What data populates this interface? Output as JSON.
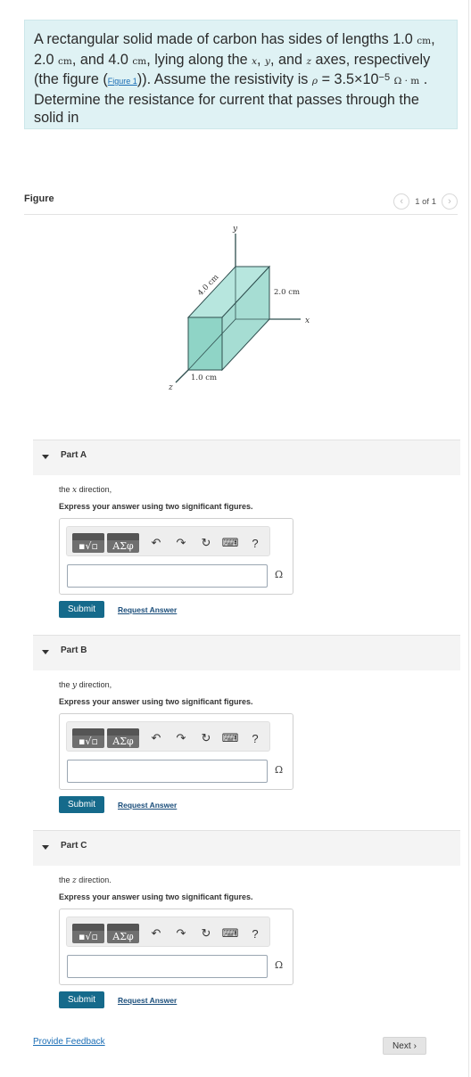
{
  "problem": {
    "t1": "A rectangular solid made of carbon has sides of lengths 1.0 ",
    "u_cm": "cm",
    "t2": ", 2.0 ",
    "t3": ", and 4.0 ",
    "t4": ", lying along the ",
    "var_x": "x",
    "sep": ", ",
    "var_y": "y",
    "t5": ", and ",
    "var_z": "z",
    "t6": " axes, respectively (the figure (",
    "figure_link": "Figure 1",
    "t7": ")). Assume the resistivity is ",
    "var_rho": "ρ",
    "t8": " = 3.5×10",
    "exp": "−5",
    "rho_unit": "Ω · m",
    "t9": " . Determine the resistance for current that passes through the solid in"
  },
  "figure": {
    "title": "Figure",
    "pager_text": "1 of 1",
    "prev_glyph": "‹",
    "next_glyph": "›",
    "labels": {
      "y": "y",
      "x": "x",
      "z": "z",
      "depth": "4.0 cm",
      "height": "2.0 cm",
      "width": "1.0 cm"
    },
    "colors": {
      "front": "#8fd4c6",
      "top": "#b7e6de",
      "side": "#a6ddd3",
      "edge": "#2f4f4f"
    }
  },
  "parts": [
    {
      "title": "Part A",
      "prompt_pre": "the ",
      "var": "x",
      "prompt_post": " direction,",
      "instruction": "Express your answer using two significant figures.",
      "unit": "Ω",
      "submit": "Submit",
      "request": "Request Answer"
    },
    {
      "title": "Part B",
      "prompt_pre": "the ",
      "var": "y",
      "prompt_post": " direction,",
      "instruction": "Express your answer using two significant figures.",
      "unit": "Ω",
      "submit": "Submit",
      "request": "Request Answer"
    },
    {
      "title": "Part C",
      "prompt_pre": "the ",
      "var": "z",
      "prompt_post": " direction.",
      "instruction": "Express your answer using two significant figures.",
      "unit": "Ω",
      "submit": "Submit",
      "request": "Request Answer"
    }
  ],
  "toolbar": {
    "template_glyph": "▪√▫",
    "greek_glyph": "ΑΣφ",
    "undo_glyph": "↶",
    "redo_glyph": "↷",
    "reset_glyph": "↻",
    "keyboard_glyph": "⌨",
    "help_glyph": "?"
  },
  "footer": {
    "feedback": "Provide Feedback",
    "next": "Next",
    "next_glyph": "›"
  }
}
